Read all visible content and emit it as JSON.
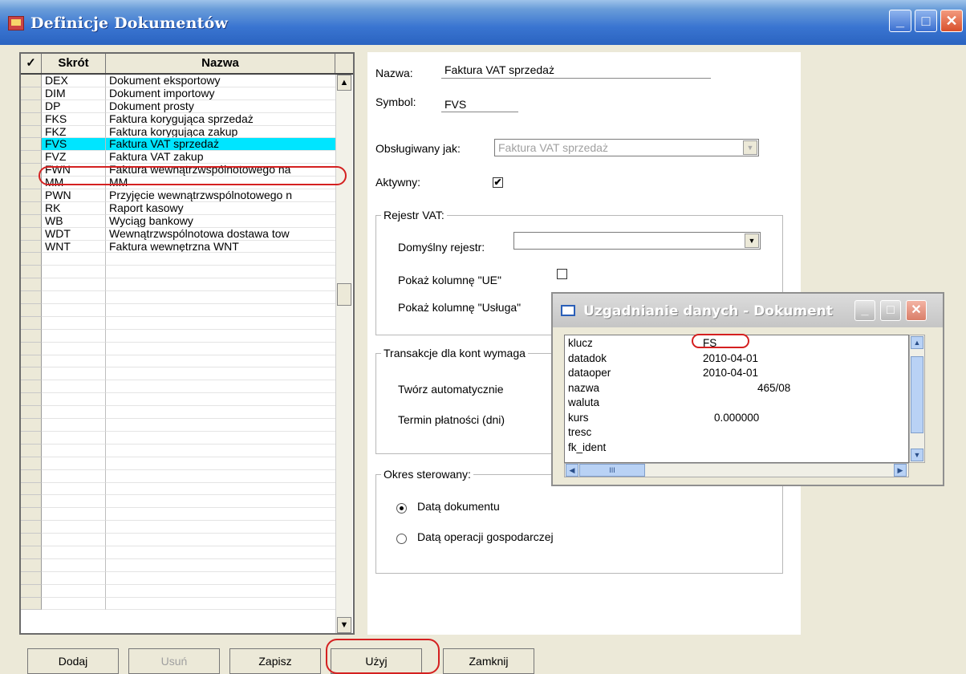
{
  "window": {
    "title": "Definicje Dokumentów",
    "icon": "document-definitions-icon"
  },
  "grid": {
    "headers": [
      "",
      "Skrót",
      "Nazwa"
    ],
    "rows": [
      {
        "code": "DEX",
        "name": "Dokument eksportowy"
      },
      {
        "code": "DIM",
        "name": "Dokument importowy"
      },
      {
        "code": "DP",
        "name": "Dokument prosty"
      },
      {
        "code": "FKS",
        "name": "Faktura korygująca sprzedaż"
      },
      {
        "code": "FKZ",
        "name": "Faktura korygująca zakup"
      },
      {
        "code": "FVS",
        "name": "Faktura VAT sprzedaż",
        "selected": true
      },
      {
        "code": "FVZ",
        "name": "Faktura VAT zakup"
      },
      {
        "code": "FWN",
        "name": "Faktura wewnątrzwspólnotowego na"
      },
      {
        "code": "MM",
        "name": "MM"
      },
      {
        "code": "PWN",
        "name": "Przyjęcie wewnątrzwspólnotowego n"
      },
      {
        "code": "RK",
        "name": "Raport kasowy"
      },
      {
        "code": "WB",
        "name": "Wyciąg bankowy"
      },
      {
        "code": "WDT",
        "name": "Wewnątrzwspólnotowa dostawa tow"
      },
      {
        "code": "WNT",
        "name": "Faktura wewnętrzna WNT"
      },
      {
        "code": "",
        "name": ""
      },
      {
        "code": "",
        "name": ""
      },
      {
        "code": "",
        "name": ""
      },
      {
        "code": "",
        "name": ""
      },
      {
        "code": "",
        "name": ""
      },
      {
        "code": "",
        "name": ""
      },
      {
        "code": "",
        "name": ""
      },
      {
        "code": "",
        "name": ""
      },
      {
        "code": "",
        "name": ""
      },
      {
        "code": "",
        "name": ""
      },
      {
        "code": "",
        "name": ""
      },
      {
        "code": "",
        "name": ""
      },
      {
        "code": "",
        "name": ""
      },
      {
        "code": "",
        "name": ""
      },
      {
        "code": "",
        "name": ""
      },
      {
        "code": "",
        "name": ""
      },
      {
        "code": "",
        "name": ""
      },
      {
        "code": "",
        "name": ""
      },
      {
        "code": "",
        "name": ""
      },
      {
        "code": "",
        "name": ""
      },
      {
        "code": "",
        "name": ""
      },
      {
        "code": "",
        "name": ""
      },
      {
        "code": "",
        "name": ""
      },
      {
        "code": "",
        "name": ""
      },
      {
        "code": "",
        "name": ""
      },
      {
        "code": "",
        "name": ""
      },
      {
        "code": "",
        "name": ""
      },
      {
        "code": "",
        "name": ""
      }
    ]
  },
  "form": {
    "nazwa_label": "Nazwa:",
    "nazwa_value": "Faktura VAT sprzedaż",
    "symbol_label": "Symbol:",
    "symbol_value": "FVS",
    "obslugiwany_label": "Obsługiwany jak:",
    "obslugiwany_value": "Faktura VAT sprzedaż",
    "aktywny_label": "Aktywny:",
    "aktywny_checked": "✔",
    "rejestr_group": "Rejestr VAT:",
    "domyslny_label": "Domyślny rejestr:",
    "domyslny_value": "",
    "pokaz_ue_label": "Pokaż kolumnę \"UE\"",
    "pokaz_usluga_label": "Pokaż kolumnę \"Usługa\"",
    "transakcje_group": "Transakcje dla kont wymaga",
    "tworz_label": "Twórz automatycznie",
    "termin_label": "Termin płatności (dni)",
    "okres_group": "Okres sterowany:",
    "radio1_label": "Datą dokumentu",
    "radio2_label": "Datą operacji gospodarczej"
  },
  "buttons": {
    "dodaj": "Dodaj",
    "usun": "Usuń",
    "zapisz": "Zapisz",
    "uzyj": "Użyj",
    "zamknij": "Zamknij"
  },
  "popup": {
    "title": "Uzgadnianie danych - Dokument",
    "rows": [
      {
        "key": "klucz",
        "value": "FS"
      },
      {
        "key": "datadok",
        "value": "2010-04-01"
      },
      {
        "key": "dataoper",
        "value": "2010-04-01"
      },
      {
        "key": "nazwa",
        "value": "465/08"
      },
      {
        "key": "waluta",
        "value": ""
      },
      {
        "key": "kurs",
        "value": "0.000000"
      },
      {
        "key": "tresc",
        "value": ""
      },
      {
        "key": "fk_ident",
        "value": ""
      }
    ]
  }
}
